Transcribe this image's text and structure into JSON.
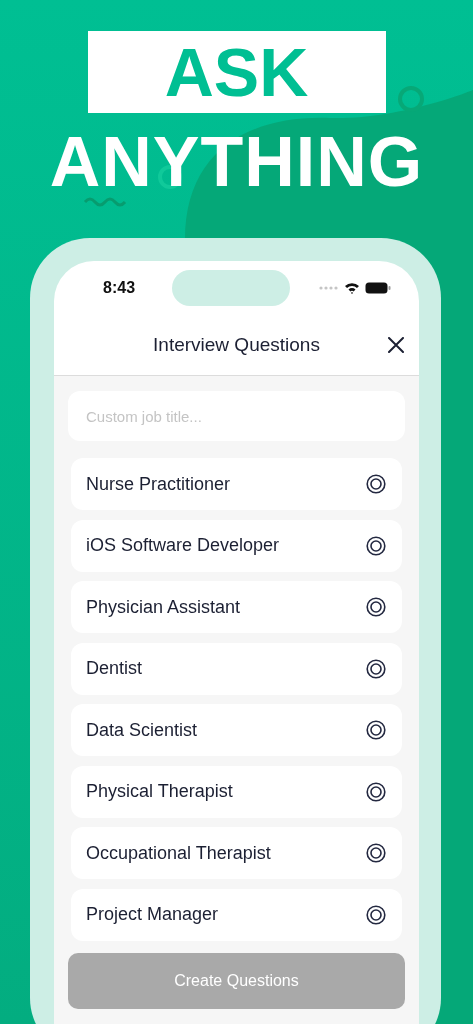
{
  "headline": {
    "boxed": "ASK",
    "plain": "ANYTHING"
  },
  "status_bar": {
    "time": "8:43"
  },
  "nav": {
    "title": "Interview Questions"
  },
  "search": {
    "placeholder": "Custom job title..."
  },
  "jobs": [
    {
      "label": "Nurse Practitioner",
      "selected": false
    },
    {
      "label": "iOS Software Developer",
      "selected": false
    },
    {
      "label": "Physician Assistant",
      "selected": false
    },
    {
      "label": "Dentist",
      "selected": false
    },
    {
      "label": "Data Scientist",
      "selected": false
    },
    {
      "label": "Physical Therapist",
      "selected": false
    },
    {
      "label": "Occupational Therapist",
      "selected": false
    },
    {
      "label": "Project Manager",
      "selected": false
    }
  ],
  "create_button": {
    "label": "Create Questions",
    "disabled": true
  }
}
